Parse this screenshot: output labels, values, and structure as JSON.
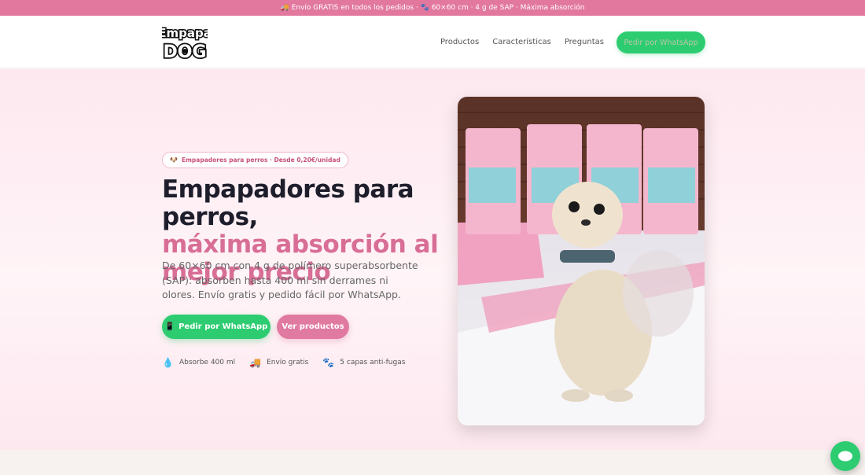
{
  "topbar": {
    "icon": "truck-icon",
    "text": "🚚 Envío GRATIS en todos los pedidos · 🐾 60×60 cm · 4 g de SAP · Máxima absorción"
  },
  "header": {
    "logo": {
      "line1": "Empapa",
      "line2": "DOG"
    },
    "nav": [
      "Productos",
      "Características",
      "Preguntas"
    ],
    "cta": "Pedir por WhatsApp"
  },
  "hero": {
    "pill": {
      "icon": "🐶",
      "text": "Empapadores para perros · Desde 0,20€/unidad"
    },
    "title_line1": "Empapadores para perros,",
    "title_line2": "máxima absorción al",
    "title_line3": "mejor precio",
    "lead": "De 60×60 cm con 4 g de polímero superabsorbente (SAP): absorben hasta 400 ml sin derrames ni olores. Envío gratis y pedido fácil por WhatsApp.",
    "btn_whatsapp": {
      "icon": "📱",
      "label": "Pedir por WhatsApp"
    },
    "btn_products": "Ver productos",
    "features": [
      {
        "icon": "💧",
        "label": "Absorbe 400 ml"
      },
      {
        "icon": "🚚",
        "label": "Envío gratis"
      },
      {
        "icon": "🐾",
        "label": "5 capas anti-fugas"
      }
    ]
  },
  "colors": {
    "primary_pink": "#e2789e",
    "whatsapp_green": "#2ecc71",
    "dark_text": "#1d1d2b",
    "accent_pink": "#d86e96"
  }
}
